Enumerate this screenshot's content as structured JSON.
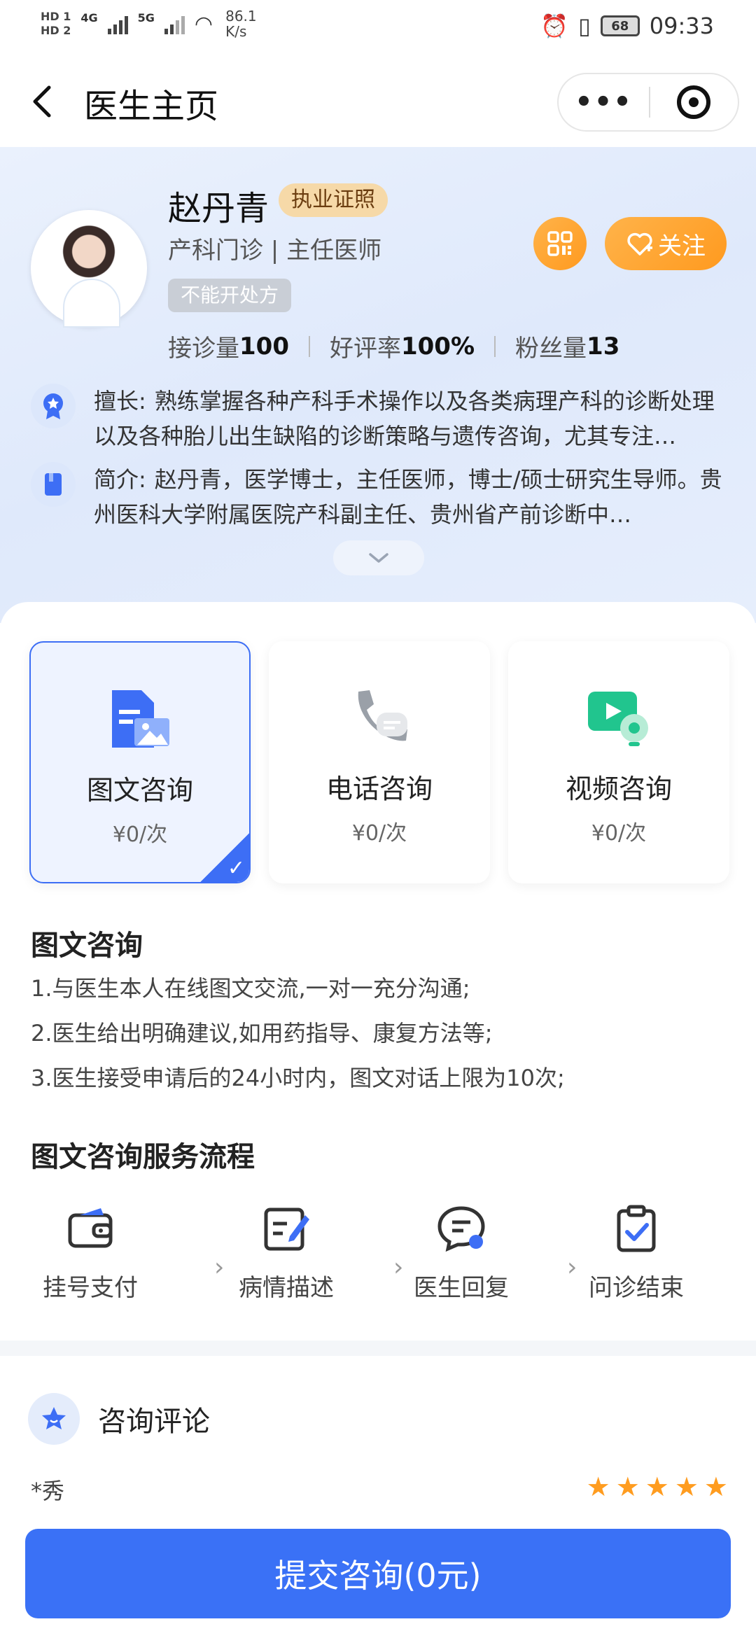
{
  "status_bar": {
    "hd1": "HD 1",
    "hd2": "HD 2",
    "net1": "4G",
    "net2": "5G",
    "speed_value": "86.1",
    "speed_unit": "K/s",
    "battery": "68",
    "time": "09:33"
  },
  "nav": {
    "title": "医生主页",
    "more": "•••"
  },
  "doctor": {
    "name": "赵丹青",
    "license_badge": "执业证照",
    "department": "产科门诊 | 主任医师",
    "follow_label": "关注",
    "prescription_tag": "不能开处方",
    "stats": {
      "consult_label": "接诊量",
      "consult_value": "100",
      "rating_label": "好评率",
      "rating_value": "100%",
      "fans_label": "粉丝量",
      "fans_value": "13"
    },
    "specialty_label": "擅长:",
    "specialty": "熟练掌握各种产科手术操作以及各类病理产科的诊断处理以及各种胎儿出生缺陷的诊断策略与遗传咨询，尤其专注…",
    "intro_label": "简介:",
    "intro": "赵丹青，医学博士，主任医师，博士/硕士研究生导师。贵州医科大学附属医院产科副主任、贵州省产前诊断中…"
  },
  "consult_types": [
    {
      "title": "图文咨询",
      "price": "¥0/次",
      "icon": "document-image-icon",
      "selected": true
    },
    {
      "title": "电话咨询",
      "price": "¥0/次",
      "icon": "phone-icon",
      "selected": false
    },
    {
      "title": "视频咨询",
      "price": "¥0/次",
      "icon": "video-camera-icon",
      "selected": false
    }
  ],
  "description": {
    "title": "图文咨询",
    "lines": [
      "1.与医生本人在线图文交流,一对一充分沟通;",
      "2.医生给出明确建议,如用药指导、康复方法等;",
      "3.医生接受申请后的24小时内，图文对话上限为10次;"
    ]
  },
  "flow": {
    "title": "图文咨询服务流程",
    "steps": [
      "挂号支付",
      "病情描述",
      "医生回复",
      "问诊结束"
    ]
  },
  "reviews": {
    "title": "咨询评论",
    "first_reviewer": "*秀",
    "first_rating": 5
  },
  "submit_label": "提交咨询(0元)",
  "colors": {
    "primary": "#3a71f6",
    "orange": "#ff9a1f",
    "license_bg": "#f6d9a8"
  }
}
